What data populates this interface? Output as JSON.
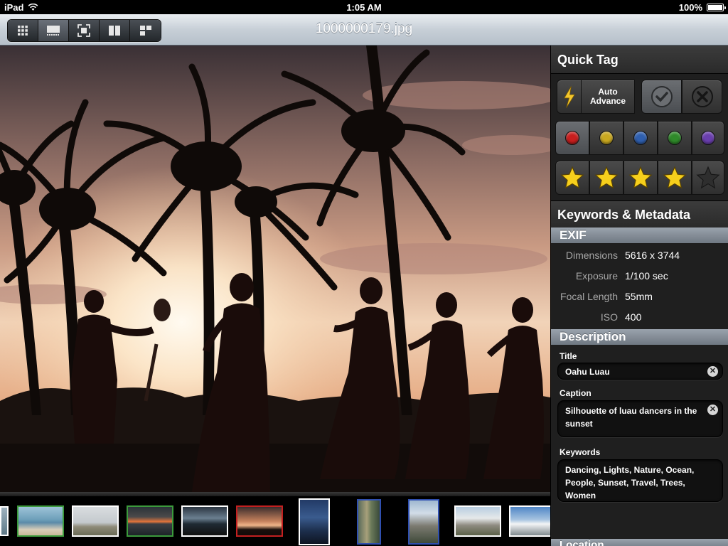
{
  "status_bar": {
    "carrier": "iPad",
    "time": "1:05 AM",
    "battery": "100%"
  },
  "toolbar": {
    "title": "1000000179.jpg",
    "view_buttons": [
      {
        "icon": "grid-icon"
      },
      {
        "icon": "filmstrip-view-icon"
      },
      {
        "icon": "fullscreen-icon"
      },
      {
        "icon": "compare-icon"
      },
      {
        "icon": "survey-icon"
      }
    ]
  },
  "quick_tag": {
    "title": "Quick Tag",
    "auto_advance_label": "Auto\nAdvance",
    "color_labels": [
      {
        "name": "red",
        "color": "#c81e1e"
      },
      {
        "name": "yellow",
        "color": "#c9a820"
      },
      {
        "name": "blue",
        "color": "#2f5fae"
      },
      {
        "name": "green",
        "color": "#2f8a2a"
      },
      {
        "name": "purple",
        "color": "#6a3fae"
      }
    ],
    "rating": 4,
    "max_rating": 5
  },
  "metadata": {
    "title": "Keywords & Metadata",
    "exif_title": "EXIF",
    "exif": [
      {
        "label": "Dimensions",
        "value": "5616 x 3744"
      },
      {
        "label": "Exposure",
        "value": "1/100 sec"
      },
      {
        "label": "Focal Length",
        "value": "55mm"
      },
      {
        "label": "ISO",
        "value": "400"
      }
    ],
    "description_title": "Description",
    "title_label": "Title",
    "title_value": "Oahu Luau",
    "caption_label": "Caption",
    "caption_value": "Silhouette of luau dancers in the sunset",
    "keywords_label": "Keywords",
    "keywords_value": "Dancing, Lights, Nature, Ocean, People, Sunset, Travel, Trees, Women",
    "location_title": "Location"
  }
}
